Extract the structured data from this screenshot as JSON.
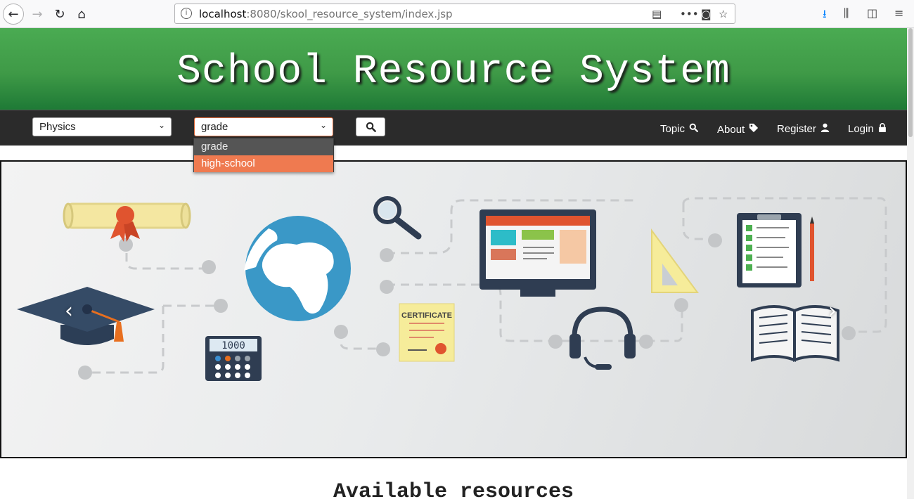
{
  "browser": {
    "url_host": "localhost",
    "url_rest": ":8080/skool_resource_system/index.jsp"
  },
  "header": {
    "title": "School Resource System"
  },
  "navbar": {
    "subject_select": "Physics",
    "level_select": "grade",
    "links": [
      "Topic",
      "About",
      "Register",
      "Login"
    ]
  },
  "dropdown": {
    "options": [
      "grade",
      "high-school"
    ],
    "highlighted": "high-school"
  },
  "carousel": {
    "certificate_text": "CERTIFICATE",
    "calculator_display": "1000"
  },
  "main": {
    "heading": "Available resources"
  },
  "colors": {
    "header_green": "#3f9a47",
    "navbar_bg": "#2b2b2b",
    "highlight": "#ef7a50"
  }
}
